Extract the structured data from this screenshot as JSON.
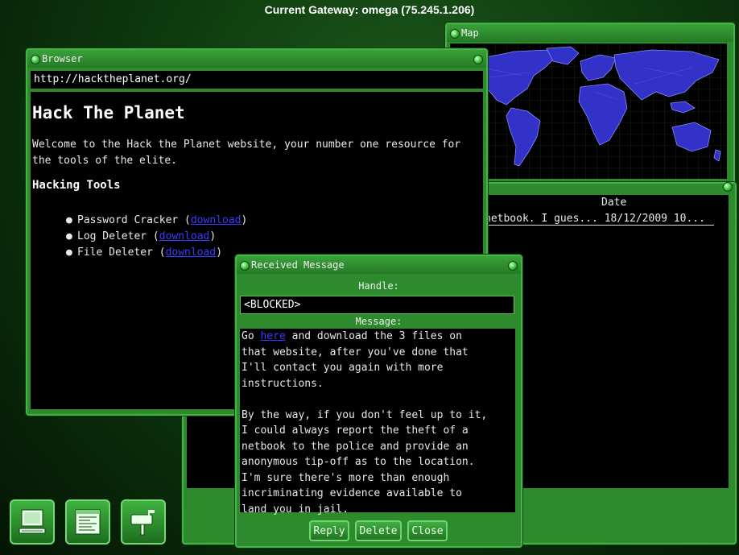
{
  "gateway": {
    "text": "Current Gateway: omega (75.245.1.206)"
  },
  "map_window": {
    "title": "Map"
  },
  "list_window": {
    "columns": [
      "Date"
    ],
    "rows": [
      {
        "subject": "netbook. I gues...",
        "date": "18/12/2009 10..."
      }
    ]
  },
  "browser": {
    "title": "Browser",
    "url": "http://hacktheplanet.org/",
    "heading": "Hack The Planet",
    "intro": "Welcome to the Hack the Planet website, your number one resource for the tools of the elite.",
    "tools_heading": "Hacking Tools",
    "tools": [
      {
        "name": "Password Cracker",
        "link": "download"
      },
      {
        "name": "Log Deleter",
        "link": "download"
      },
      {
        "name": "File Deleter",
        "link": "download"
      }
    ]
  },
  "message": {
    "title": "Received Message",
    "handle_label": "Handle:",
    "handle_value": "<BLOCKED>",
    "message_label": "Message:",
    "link_text": "here",
    "body_pre": "Go ",
    "body_post": " and download the 3 files on\nthat website, after you've done that\nI'll contact you again with more\ninstructions.\n\nBy the way, if you don't feel up to it,\nI could always report the theft of a\nnetbook to the police and provide an\nanonymous tip-off as to the location.\nI'm sure there's more than enough\nincriminating evidence available to\nland you in jail.",
    "buttons": {
      "reply": "Reply",
      "delete": "Delete",
      "close": "Close"
    }
  },
  "dock": {
    "items": [
      {
        "icon": "computer-icon"
      },
      {
        "icon": "document-window-icon"
      },
      {
        "icon": "mailbox-icon"
      }
    ]
  }
}
